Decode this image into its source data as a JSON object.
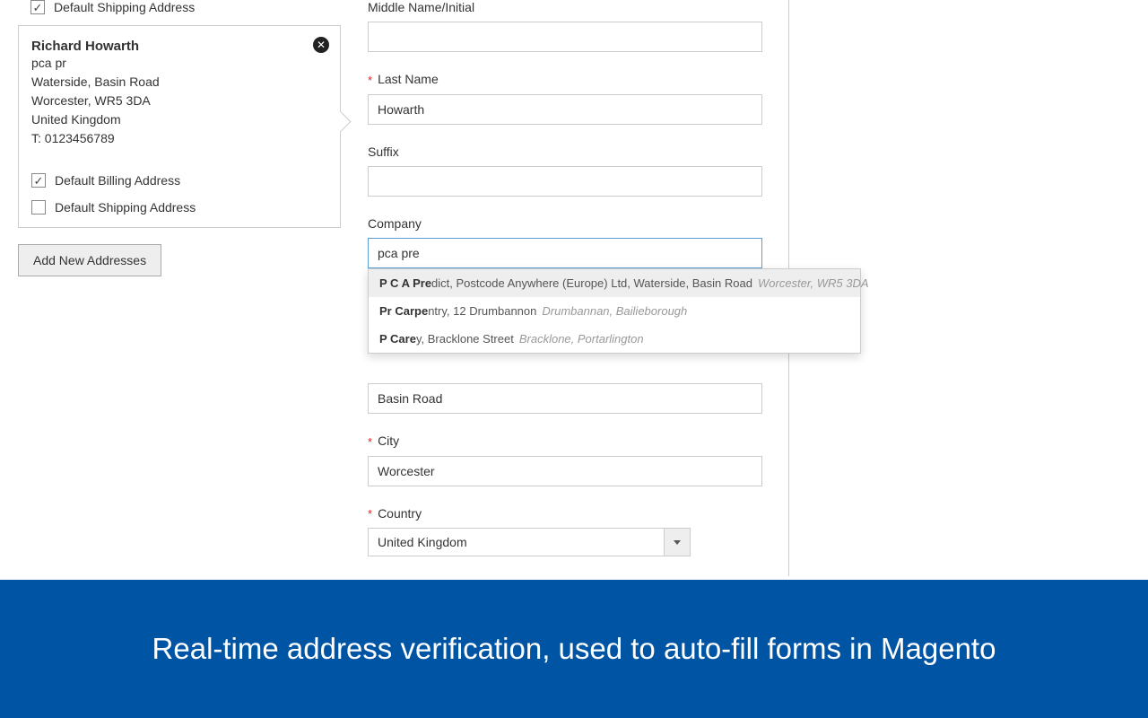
{
  "sidebar": {
    "partial_card": {
      "shipping_label": "Default Shipping Address"
    },
    "card": {
      "name": "Richard Howarth",
      "line1": "pca pr",
      "line2": "Waterside, Basin Road",
      "line3": "Worcester, WR5 3DA",
      "line4": "United Kingdom",
      "line5": "T: 0123456789",
      "billing_label": "Default Billing Address",
      "shipping_label": "Default Shipping Address"
    },
    "add_btn": "Add New Addresses"
  },
  "form": {
    "middle_label": "Middle Name/Initial",
    "middle_value": "",
    "last_label": "Last Name",
    "last_value": "Howarth",
    "suffix_label": "Suffix",
    "suffix_value": "",
    "company_label": "Company",
    "company_value": "pca pre",
    "street_value": "Basin Road",
    "city_label": "City",
    "city_value": "Worcester",
    "country_label": "Country",
    "country_value": "United Kingdom"
  },
  "suggestions": [
    {
      "bold": "P C A Pre",
      "rest": "dict, Postcode Anywhere (Europe) Ltd, Waterside, Basin Road",
      "sub": "Worcester, WR5 3DA"
    },
    {
      "bold": "Pr Carpe",
      "rest": "ntry, 12 Drumbannon",
      "sub": "Drumbannan, Bailieborough"
    },
    {
      "bold": "P Care",
      "rest": "y, Bracklone Street",
      "sub": "Bracklone, Portarlington"
    }
  ],
  "banner": "Real-time address verification, used to auto-fill forms in Magento"
}
